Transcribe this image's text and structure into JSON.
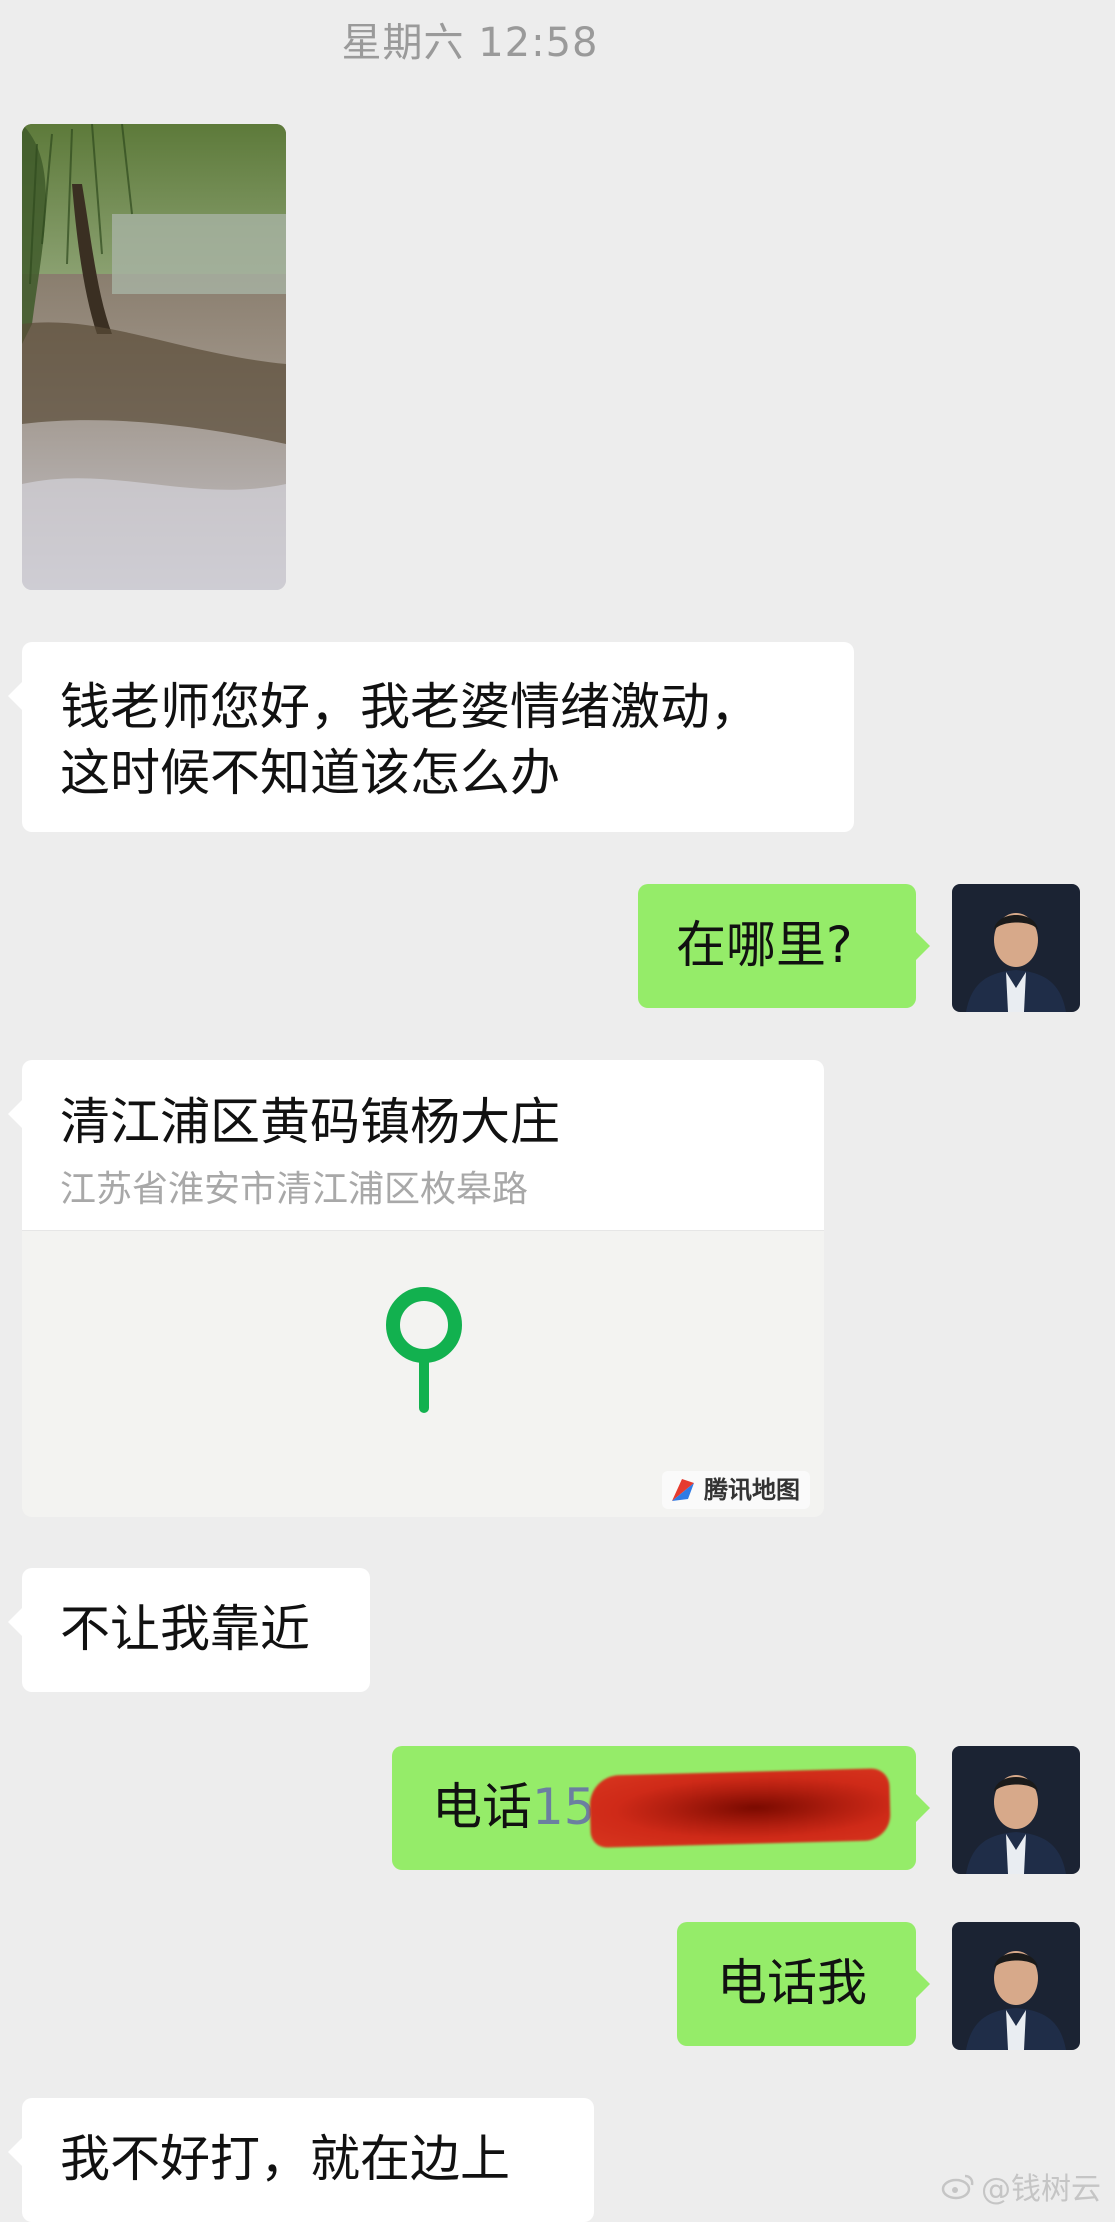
{
  "header": {
    "timestamp": "星期六 12:58"
  },
  "messages": {
    "m1_line1": "钱老师您好，我老婆情绪激动，",
    "m1_line2": "这时候不知道该怎么办",
    "m2": "在哪里?",
    "location": {
      "title": "清江浦区黄码镇杨大庄",
      "address": "江苏省淮安市清江浦区枚皋路",
      "map_brand": "腾讯地图"
    },
    "m3": "不让我靠近",
    "m4_label": "电话",
    "m4_number_visible": "150",
    "m5": "电话我",
    "m6": "我不好打，就在边上"
  },
  "watermark": {
    "text": "@钱树云"
  },
  "colors": {
    "background": "#ededed",
    "incoming_bubble": "#ffffff",
    "outgoing_bubble": "#95ec69",
    "map_pin": "#12b14f"
  },
  "icons": [
    "photo-thumbnail",
    "avatar",
    "map-pin-icon",
    "tencent-map-logo-icon",
    "weibo-icon"
  ]
}
